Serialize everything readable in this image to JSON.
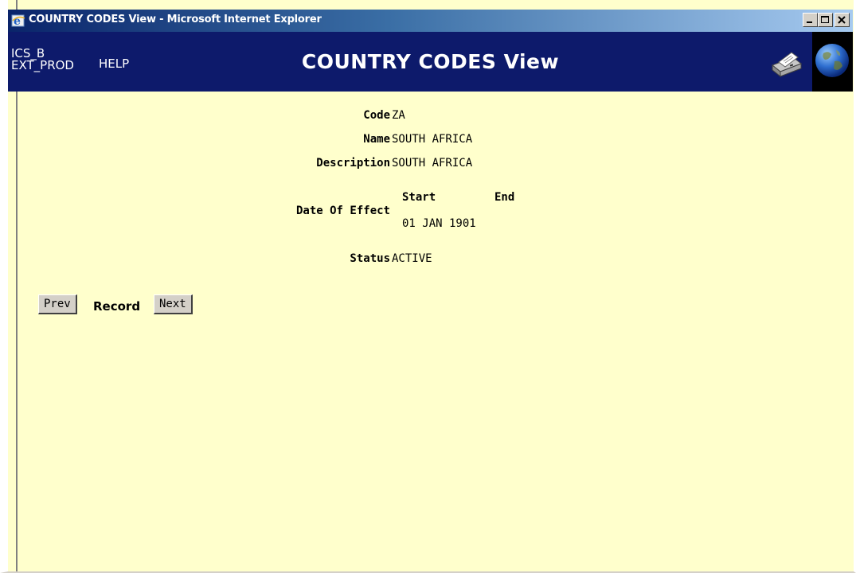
{
  "window": {
    "title": "COUNTRY CODES View - Microsoft Internet Explorer"
  },
  "header": {
    "user_line1": "ICS_B",
    "user_line2": "EXT_PROD",
    "help_label": "HELP",
    "heading": "COUNTRY CODES View"
  },
  "record": {
    "code_label": "Code",
    "code_value": "ZA",
    "name_label": "Name",
    "name_value": "SOUTH AFRICA",
    "description_label": "Description",
    "description_value": "SOUTH AFRICA",
    "date_of_effect_label": "Date Of Effect",
    "start_label": "Start",
    "end_label": "End",
    "start_value": "01 JAN 1901",
    "end_value": "",
    "status_label": "Status",
    "status_value": "ACTIVE"
  },
  "navigation": {
    "prev_label": "Prev",
    "record_label": "Record",
    "next_label": "Next"
  },
  "colors": {
    "page_background": "#ffffcc",
    "header_background": "#0d1a6b",
    "header_text": "#ffffff"
  },
  "icons": {
    "titlebar": "internet-explorer-icon",
    "print": "printer-icon",
    "home": "globe-icon"
  }
}
